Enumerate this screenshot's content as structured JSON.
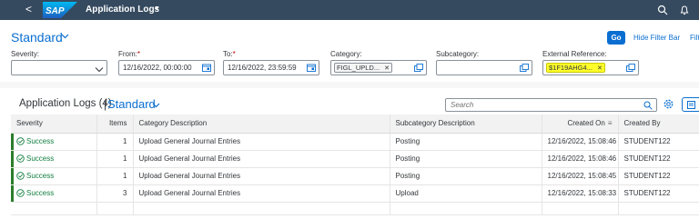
{
  "shell": {
    "back_glyph": "<",
    "app_title": "Application Logs",
    "title_caret": "▼"
  },
  "filter_bar": {
    "variant": "Standard",
    "go_label": "Go",
    "hide_filter_label": "Hide Filter Bar",
    "more_label": "Filt",
    "fields": {
      "severity": {
        "label": "Severity:",
        "value": ""
      },
      "from": {
        "label": "From:",
        "required": "*",
        "value": "12/16/2022, 00:00:00"
      },
      "to": {
        "label": "To:",
        "required": "*",
        "value": "12/16/2022, 23:59:59"
      },
      "category": {
        "label": "Category:",
        "token": "FIGL_UPLD..."
      },
      "subcategory": {
        "label": "Subcategory:",
        "value": ""
      },
      "external_reference": {
        "label": "External Reference:",
        "token": "$1F19AHG4..."
      }
    }
  },
  "table_toolbar": {
    "title": "Application Logs (4)",
    "separator": "|",
    "variant": "Standard",
    "search_placeholder": "Search"
  },
  "table": {
    "columns": [
      "Severity",
      "Items",
      "Category Description",
      "Subcategory Description",
      "Created On",
      "Created By"
    ],
    "rows": [
      {
        "severity": "Success",
        "items": "1",
        "category": "Upload General Journal Entries",
        "subcategory": "Posting",
        "created_on": "12/16/2022, 15:08:46",
        "created_by": "STUDENT122"
      },
      {
        "severity": "Success",
        "items": "1",
        "category": "Upload General Journal Entries",
        "subcategory": "Posting",
        "created_on": "12/16/2022, 15:08:46",
        "created_by": "STUDENT122"
      },
      {
        "severity": "Success",
        "items": "1",
        "category": "Upload General Journal Entries",
        "subcategory": "Posting",
        "created_on": "12/16/2022, 15:08:45",
        "created_by": "STUDENT122"
      },
      {
        "severity": "Success",
        "items": "3",
        "category": "Upload General Journal Entries",
        "subcategory": "Upload",
        "created_on": "12/16/2022, 15:08:33",
        "created_by": "STUDENT122"
      }
    ]
  },
  "icons": {
    "search": "search-icon",
    "bell": "bell-icon",
    "calendar": "calendar-icon",
    "value_help": "value-help-icon",
    "settings": "gear-icon",
    "export": "export-icon",
    "success": "success-check-icon",
    "sort": "sort-descending-icon"
  },
  "colors": {
    "shell": "#354a5f",
    "accent": "#0a6ed1",
    "success": "#107e3e",
    "highlight": "#ffff2a",
    "required": "#bb0000"
  }
}
